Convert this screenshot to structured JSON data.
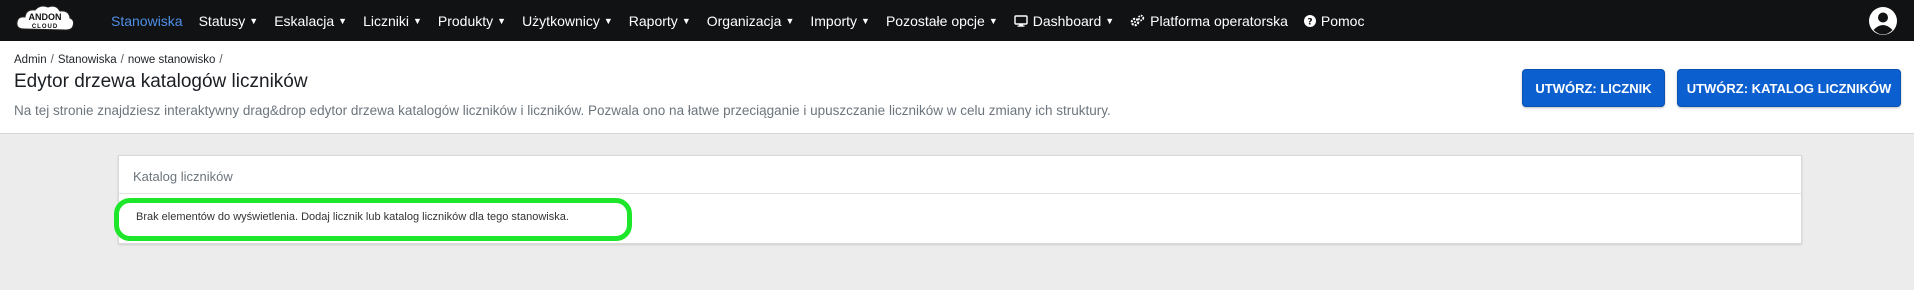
{
  "navbar": {
    "logo_text_top": "ANDON",
    "logo_text_bottom": "CLOUD",
    "items": [
      {
        "label": "Stanowiska",
        "active": true,
        "dropdown": false,
        "icon": ""
      },
      {
        "label": "Statusy",
        "active": false,
        "dropdown": true,
        "icon": ""
      },
      {
        "label": "Eskalacja",
        "active": false,
        "dropdown": true,
        "icon": ""
      },
      {
        "label": "Liczniki",
        "active": false,
        "dropdown": true,
        "icon": ""
      },
      {
        "label": "Produkty",
        "active": false,
        "dropdown": true,
        "icon": ""
      },
      {
        "label": "Użytkownicy",
        "active": false,
        "dropdown": true,
        "icon": ""
      },
      {
        "label": "Raporty",
        "active": false,
        "dropdown": true,
        "icon": ""
      },
      {
        "label": "Organizacja",
        "active": false,
        "dropdown": true,
        "icon": ""
      },
      {
        "label": "Importy",
        "active": false,
        "dropdown": true,
        "icon": ""
      },
      {
        "label": "Pozostałe opcje",
        "active": false,
        "dropdown": true,
        "icon": ""
      },
      {
        "label": "Dashboard",
        "active": false,
        "dropdown": true,
        "icon": "monitor-icon"
      },
      {
        "label": "Platforma operatorska",
        "active": false,
        "dropdown": false,
        "icon": "gears-icon"
      },
      {
        "label": "Pomoc",
        "active": false,
        "dropdown": false,
        "icon": "question-circle-icon"
      }
    ],
    "caret": "▼",
    "user_icon": "user-circle-icon"
  },
  "breadcrumb": [
    "Admin",
    "Stanowiska",
    "nowe stanowisko"
  ],
  "breadcrumb_sep": "/",
  "page": {
    "title": "Edytor drzewa katalogów liczników",
    "description": "Na tej stronie znajdziesz interaktywny drag&drop edytor drzewa katalogów liczników i liczników. Pozwala ono na łatwe przeciąganie i upuszczanie liczników w celu zmiany ich struktury."
  },
  "buttons": {
    "create_counter": "UTWÓRZ: LICZNIK",
    "create_catalog": "UTWÓRZ: KATALOG LICZNIKÓW"
  },
  "card": {
    "header": "Katalog liczników",
    "empty_message": "Brak elementów do wyświetlenia. Dodaj licznik lub katalog liczników dla tego stanowiska."
  },
  "colors": {
    "nav_bg": "#111214",
    "nav_active": "#4e8fe6",
    "primary_button": "#0b5fcf",
    "highlight": "#1ee62a",
    "page_bg": "#ececec"
  }
}
